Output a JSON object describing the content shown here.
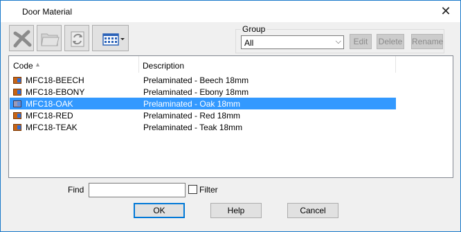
{
  "window": {
    "title": "Door Material",
    "close_glyph": "✕"
  },
  "toolbar": {
    "buttons": [
      {
        "icon": "delete-cross-icon"
      },
      {
        "icon": "folder-icon"
      },
      {
        "icon": "refresh-icon"
      },
      {
        "icon": "view-mode-icon"
      }
    ]
  },
  "group": {
    "label": "Group",
    "selected": "All",
    "edit_label": "Edit",
    "delete_label": "Delete",
    "rename_label": "Rename"
  },
  "list": {
    "columns": [
      "Code",
      "Description"
    ],
    "rows": [
      {
        "code": "MFC18-BEECH",
        "description": "Prelaminated - Beech 18mm",
        "selected": false
      },
      {
        "code": "MFC18-EBONY",
        "description": "Prelaminated - Ebony 18mm",
        "selected": false
      },
      {
        "code": "MFC18-OAK",
        "description": "Prelaminated - Oak 18mm",
        "selected": true
      },
      {
        "code": "MFC18-RED",
        "description": "Prelaminated - Red 18mm",
        "selected": false
      },
      {
        "code": "MFC18-TEAK",
        "description": "Prelaminated - Teak 18mm",
        "selected": false
      }
    ]
  },
  "find": {
    "label": "Find",
    "value": "",
    "filter_label": "Filter",
    "filter_checked": false
  },
  "buttons": {
    "ok": "OK",
    "help": "Help",
    "cancel": "Cancel"
  },
  "colors": {
    "selection": "#3399ff",
    "window_border": "#1979ca"
  }
}
